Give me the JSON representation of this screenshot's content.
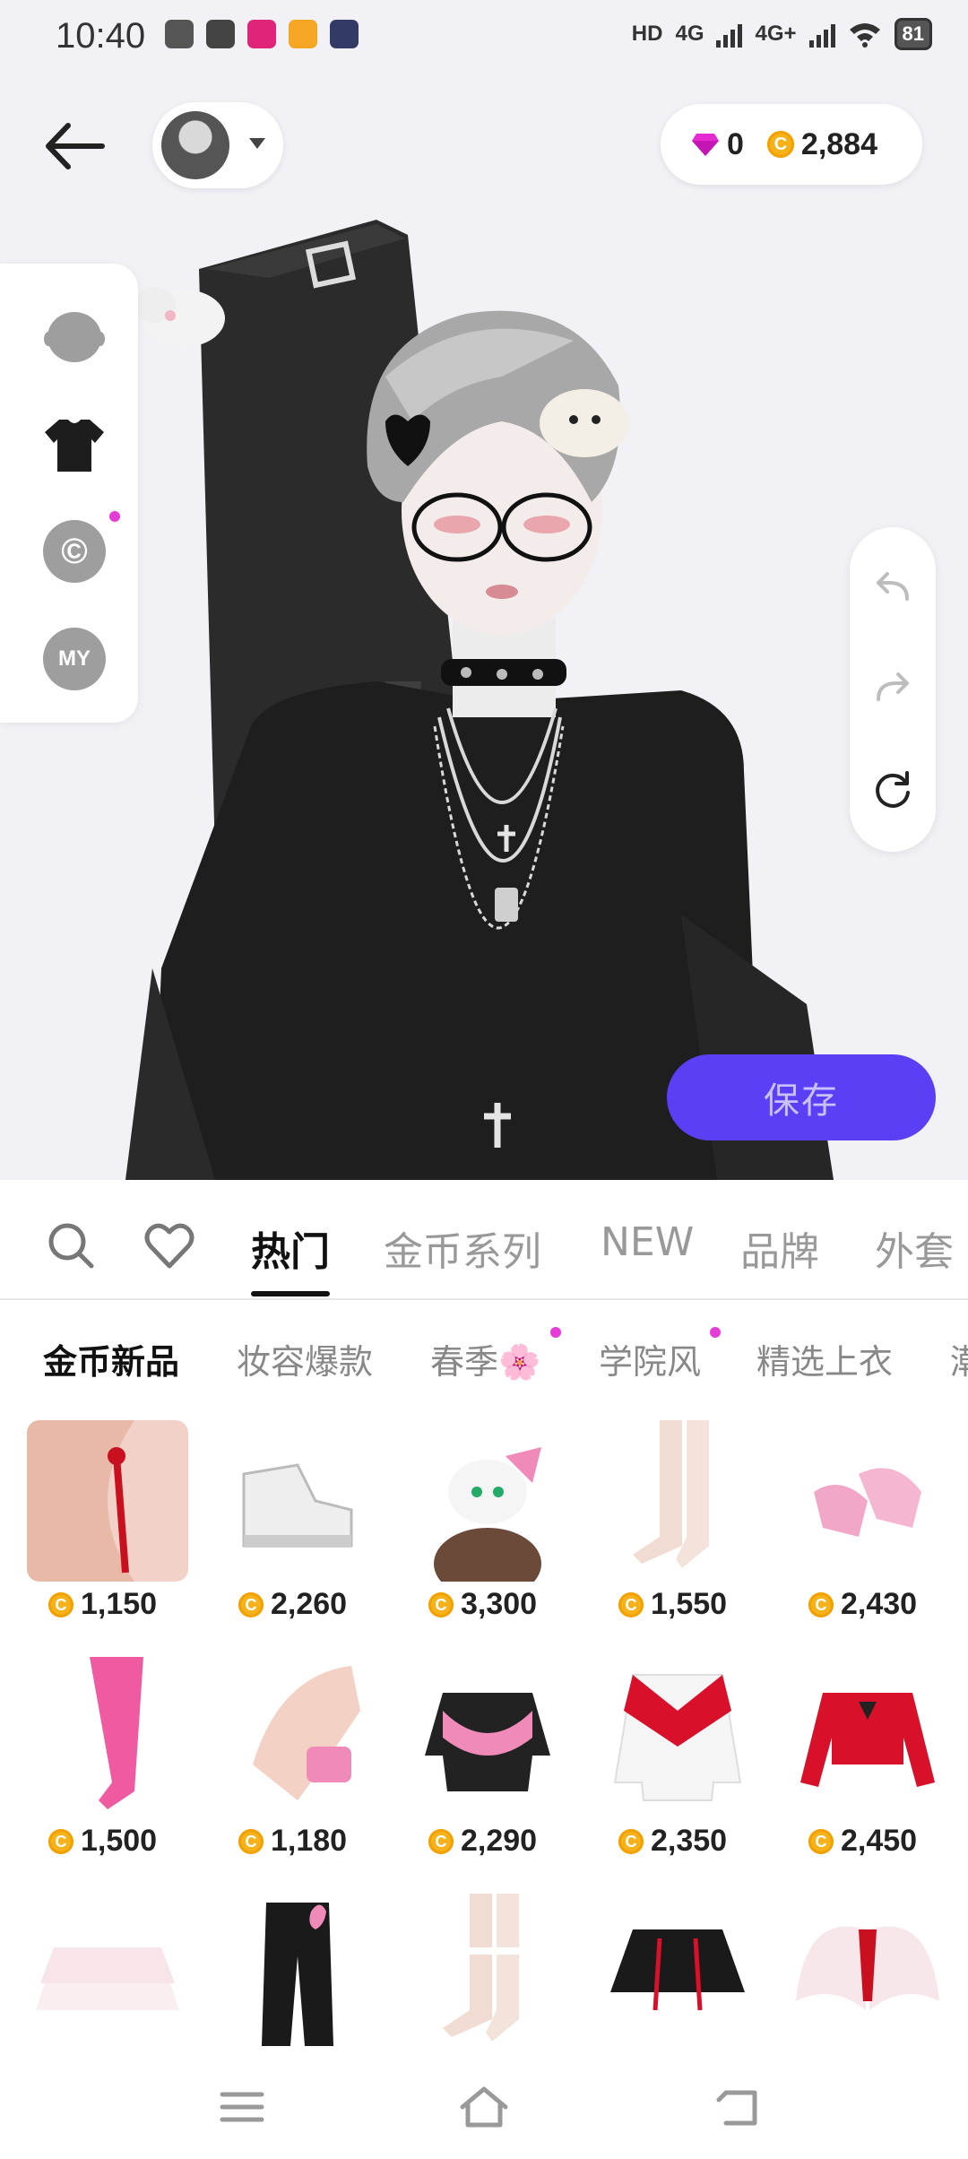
{
  "status": {
    "time": "10:40",
    "hd_label": "HD",
    "net1": "4G",
    "net2": "4G+",
    "battery": "81",
    "app_colors": [
      "#555555",
      "#444444",
      "#e0247a",
      "#f5a623",
      "#333a66"
    ]
  },
  "header": {
    "gem_count": "0",
    "coin_count": "2,884"
  },
  "left_rail": {
    "items": [
      "head-icon",
      "shirt-icon",
      "copyright-icon",
      "my-icon"
    ],
    "my_label": "MY",
    "copy_label": "©"
  },
  "save_label": "保存",
  "tabs": {
    "items": [
      "热门",
      "金币系列",
      "NEW",
      "品牌",
      "外套"
    ],
    "active": "热门"
  },
  "subtabs": {
    "items": [
      "金币新品",
      "妆容爆款",
      "春季🌸",
      "学院风",
      "精选上衣",
      "潮"
    ],
    "active": "金币新品"
  },
  "items": [
    {
      "price": "1,150",
      "kind": "ribbon-earring"
    },
    {
      "price": "2,260",
      "kind": "white-sneakers"
    },
    {
      "price": "3,300",
      "kind": "cat-headband"
    },
    {
      "price": "1,550",
      "kind": "sheer-socks"
    },
    {
      "price": "2,430",
      "kind": "pink-heels"
    },
    {
      "price": "1,500",
      "kind": "pink-tights"
    },
    {
      "price": "1,180",
      "kind": "heart-ring"
    },
    {
      "price": "2,290",
      "kind": "pink-jacket"
    },
    {
      "price": "2,350",
      "kind": "heart-cardigan"
    },
    {
      "price": "2,450",
      "kind": "red-top"
    },
    {
      "price": "",
      "kind": "frill-skirt"
    },
    {
      "price": "",
      "kind": "black-pants"
    },
    {
      "price": "",
      "kind": "lace-socks"
    },
    {
      "price": "",
      "kind": "black-skirt"
    },
    {
      "price": "",
      "kind": "angel-wings"
    }
  ]
}
